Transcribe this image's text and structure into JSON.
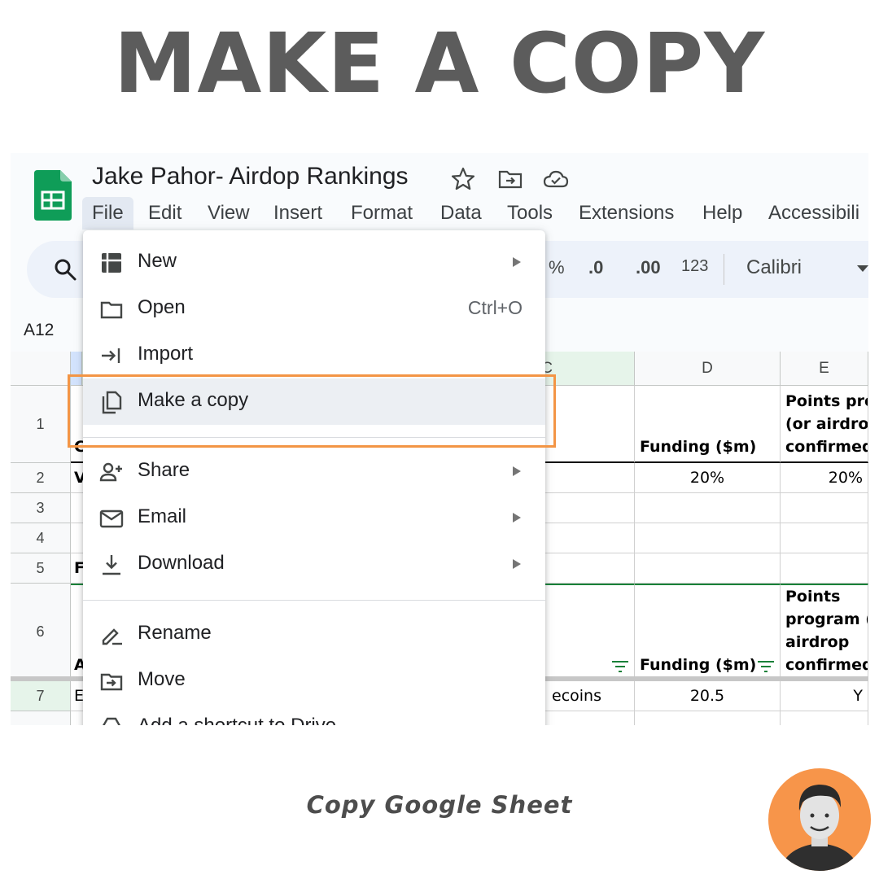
{
  "headline": "MAKE A COPY",
  "caption": "Copy Google Sheet",
  "colors": {
    "accent_orange": "#f39545",
    "headline_gray": "#5c5c5c",
    "sheets_green": "#0f9d58",
    "filter_green": "#188038"
  },
  "sheet": {
    "title": "Jake Pahor- Airdop Rankings",
    "title_icons": [
      "star-icon",
      "move-to-folder-icon",
      "cloud-saved-icon"
    ],
    "menus": [
      "File",
      "Edit",
      "View",
      "Insert",
      "Format",
      "Data",
      "Tools",
      "Extensions",
      "Help",
      "Accessibili"
    ],
    "active_menu": "File",
    "toolbar": {
      "percent": "%",
      "decrease_decimal": ".0",
      "increase_decimal": ".00",
      "number_format": "123",
      "font": "Calibri"
    },
    "name_box": "A12",
    "columns": [
      "C",
      "D",
      "E"
    ],
    "rows": [
      "1",
      "2",
      "3",
      "4",
      "5",
      "6",
      "7"
    ],
    "cells": {
      "row1_a": "C",
      "row1_d": "Funding ($m)",
      "row1_e": "Points prog\n(or airdrop\nconfirmed)",
      "row2_a": "V",
      "row2_d": "20%",
      "row2_e": "20%",
      "row5_a": "F",
      "row6_a": "A",
      "row6_d": "Funding ($m)",
      "row6_e": "Points\nprogram (o\nairdrop\nconfirmed)",
      "row7_a": "E",
      "row7_c": "ecoins",
      "row7_d": "20.5",
      "row7_e": "Y"
    }
  },
  "file_menu": {
    "items": [
      {
        "label": "New",
        "icon": "new-spreadsheet-icon",
        "submenu": true
      },
      {
        "label": "Open",
        "icon": "folder-icon",
        "shortcut": "Ctrl+O"
      },
      {
        "label": "Import",
        "icon": "import-icon"
      },
      {
        "label": "Make a copy",
        "icon": "copy-icon",
        "highlighted": true
      },
      {
        "label": "Share",
        "icon": "share-person-icon",
        "submenu": true
      },
      {
        "label": "Email",
        "icon": "email-icon",
        "submenu": true
      },
      {
        "label": "Download",
        "icon": "download-icon",
        "submenu": true
      },
      {
        "label": "Rename",
        "icon": "rename-icon"
      },
      {
        "label": "Move",
        "icon": "move-icon"
      },
      {
        "label": "Add a shortcut to Drive",
        "icon": "drive-shortcut-icon"
      }
    ]
  }
}
